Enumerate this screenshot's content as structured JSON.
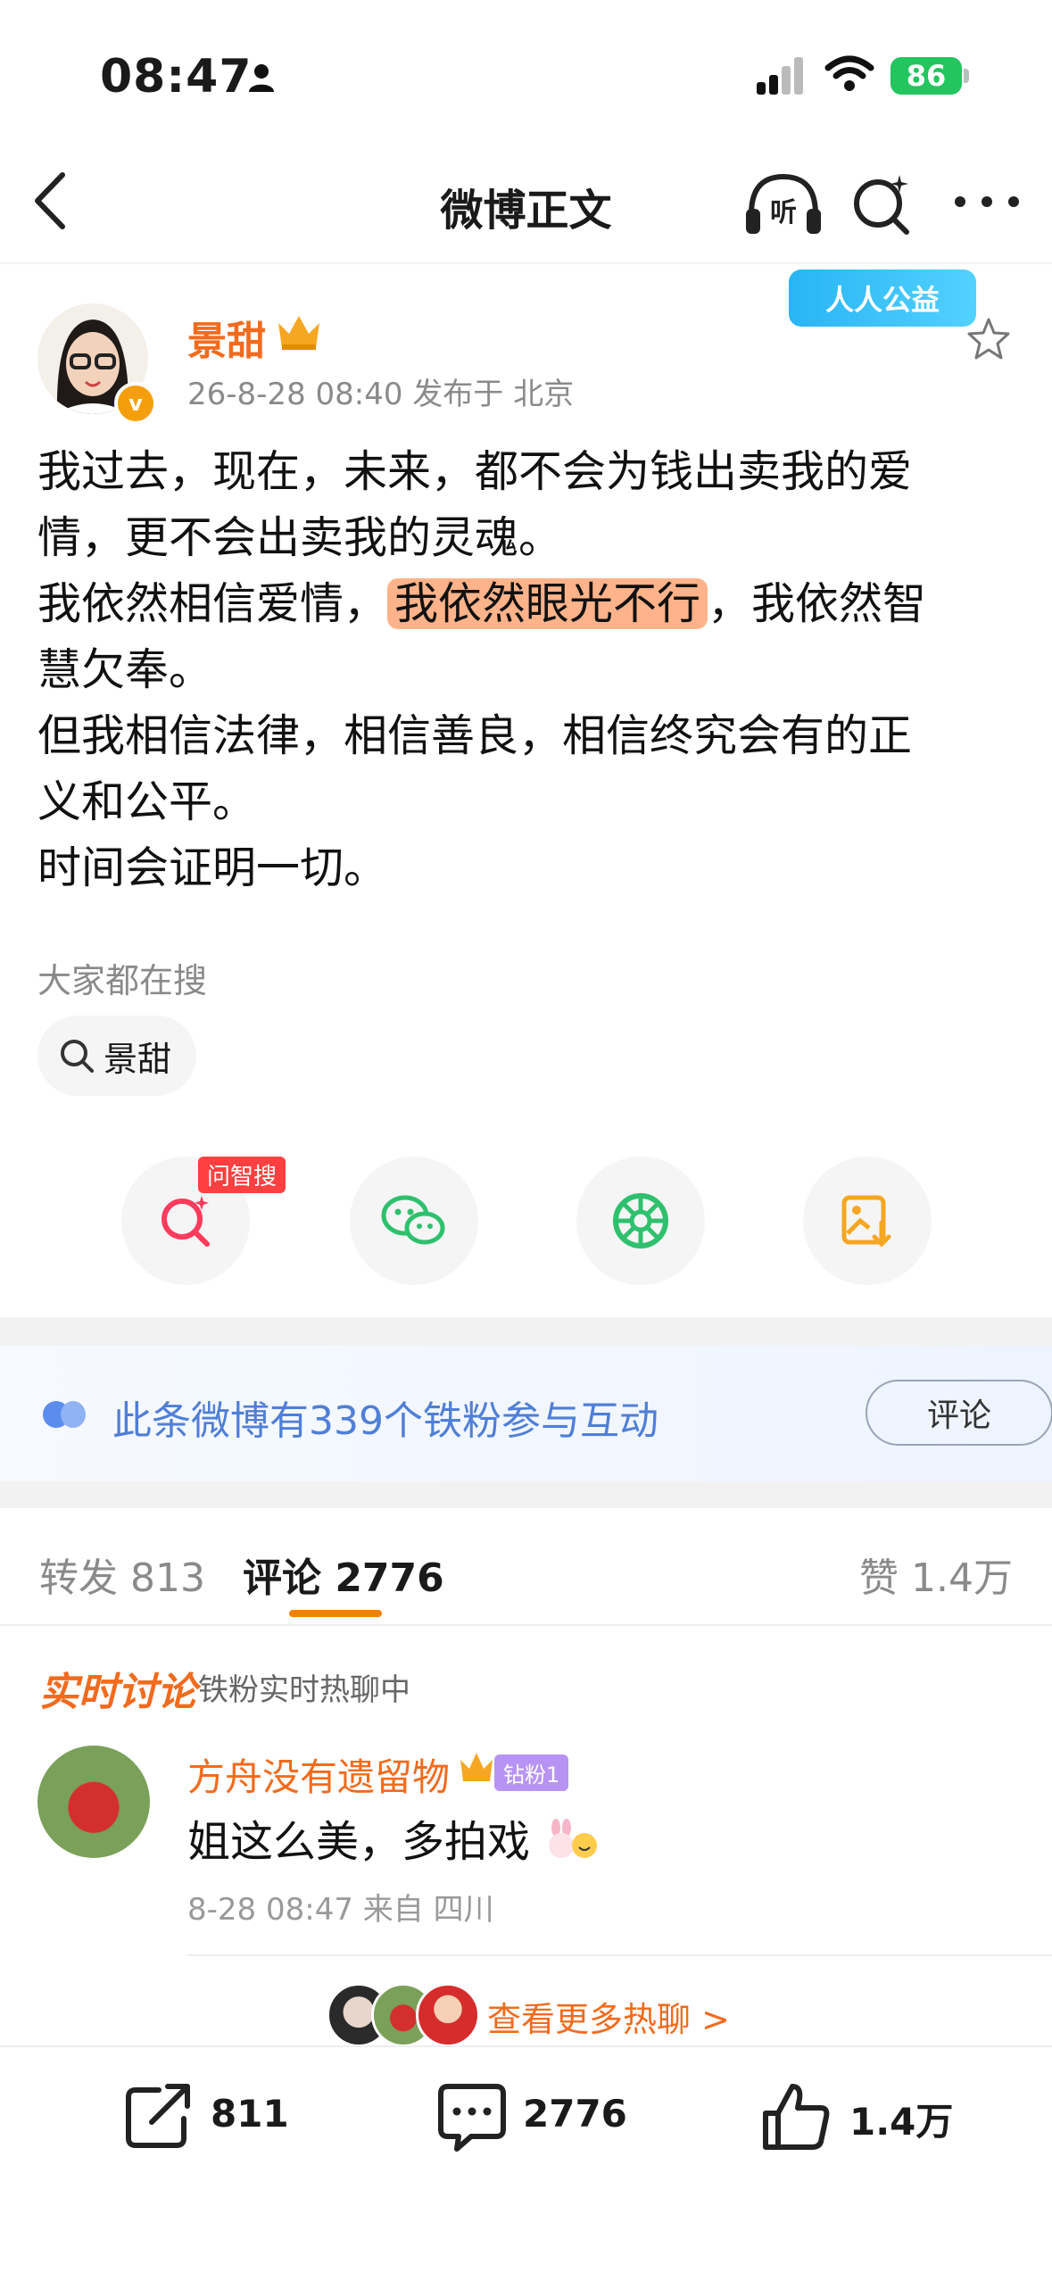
{
  "status_bar": {
    "time": "08:47",
    "battery": "86"
  },
  "nav": {
    "title": "微博正文",
    "listen_label": "听"
  },
  "post": {
    "author": "景甜",
    "avatar_badge": "v",
    "meta": "26-8-28 08:40  发布于 北京",
    "promo": "人人公益",
    "lines": [
      "我过去，现在，未来，都不会为钱出卖我的爱",
      "情，更不会出卖我的灵魂。",
      "我依然相信爱情，",
      "我依然眼光不行",
      "，我依然智",
      "慧欠奉。",
      "但我相信法律，相信善良，相信终究会有的正",
      "义和公平。",
      "时间会证明一切。"
    ]
  },
  "search": {
    "label": "大家都在搜",
    "chip": "景甜"
  },
  "share_actions": {
    "ask_badge": "问智搜"
  },
  "fans": {
    "text": "此条微博有339个铁粉参与互动",
    "button": "评论"
  },
  "tabs": {
    "repost": "转发 813",
    "comments": "评论 2776",
    "likes": "赞 1.4万"
  },
  "live": {
    "title": "实时讨论",
    "subtitle": "铁粉实时热聊中"
  },
  "comment": {
    "author": "方舟没有遗留物",
    "fan_badge": "钻粉1",
    "text": "姐这么美，多拍戏",
    "meta": "8-28 08:47  来自 四川"
  },
  "more_hot": "查看更多热聊 >",
  "bottom_bar": {
    "repost": "811",
    "comment": "2776",
    "like": "1.4万"
  }
}
